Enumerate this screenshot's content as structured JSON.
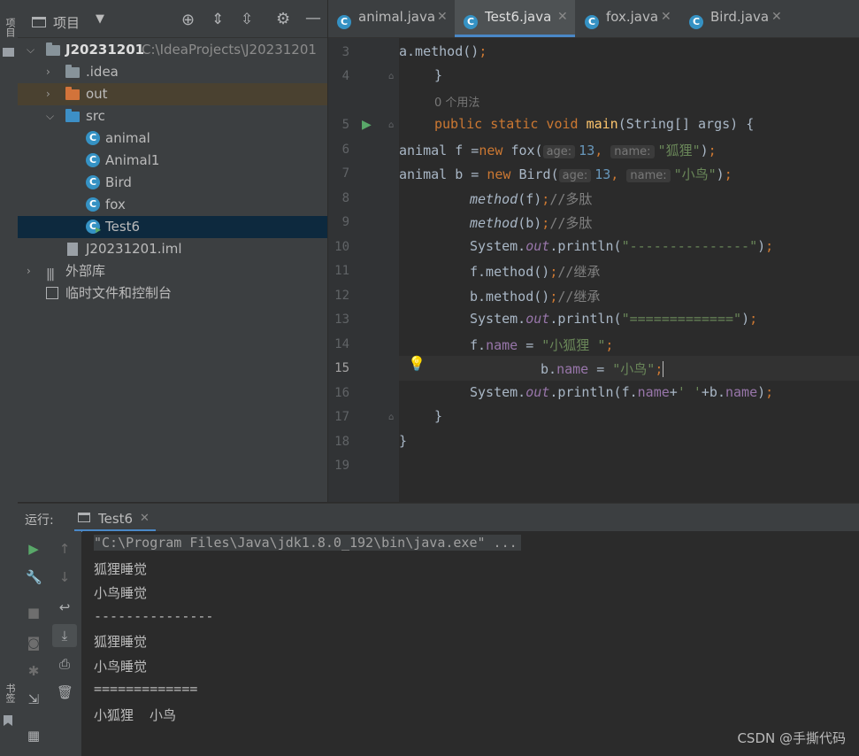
{
  "left_strip": {
    "project_label": "项目",
    "bookmarks_label": "书签"
  },
  "project_panel": {
    "title": "项目",
    "tree": [
      {
        "name": "J20231201",
        "path": "C:\\IdeaProjects\\J20231201"
      },
      {
        "name": ".idea"
      },
      {
        "name": "out"
      },
      {
        "name": "src"
      },
      {
        "name": "animal"
      },
      {
        "name": "Animal1"
      },
      {
        "name": "Bird"
      },
      {
        "name": "fox"
      },
      {
        "name": "Test6"
      },
      {
        "name": "J20231201.iml"
      },
      {
        "name": "外部库"
      },
      {
        "name": "临时文件和控制台"
      }
    ]
  },
  "tabs": [
    {
      "label": "animal.java",
      "icon": "C"
    },
    {
      "label": "Test6.java",
      "icon": "C"
    },
    {
      "label": "fox.java",
      "icon": "C"
    },
    {
      "label": "Bird.java",
      "icon": "C"
    }
  ],
  "editor": {
    "line_numbers": [
      "3",
      "4",
      "5",
      "6",
      "7",
      "8",
      "9",
      "10",
      "11",
      "12",
      "13",
      "14",
      "15",
      "16",
      "17",
      "18",
      "19"
    ],
    "current_line": "15",
    "usage_hint": "0 个用法",
    "hints": {
      "age": "age:",
      "name": "name:"
    }
  },
  "run": {
    "label": "运行:",
    "tab": "Test6",
    "console": [
      "\"C:\\Program Files\\Java\\jdk1.8.0_192\\bin\\java.exe\" ...",
      "狐狸睡觉",
      "小鸟睡觉",
      "---------------",
      "狐狸睡觉",
      "小鸟睡觉",
      "=============",
      "小狐狸  小鸟"
    ]
  },
  "watermark": "CSDN @手撕代码",
  "colors": {
    "keyword": "#cc7832",
    "function": "#ffc66d",
    "string": "#6a8759",
    "number": "#6897bb",
    "field": "#9876aa",
    "accent": "#4a88c7"
  }
}
